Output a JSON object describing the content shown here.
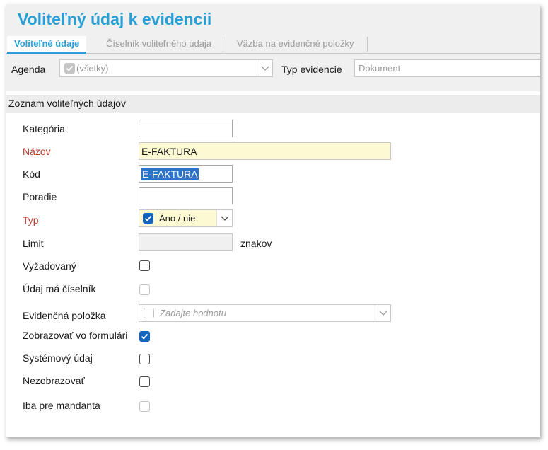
{
  "window": {
    "title": "Voliteľný údaj k evidencii"
  },
  "tabs": [
    {
      "label": "Voliteľné údaje",
      "active": true
    },
    {
      "label": "Číselník voliteľného údaja",
      "active": false
    },
    {
      "label": "Väzba na evidenčné položky",
      "active": false
    }
  ],
  "filter": {
    "agenda_label": "Agenda",
    "agenda_value": "(všetky)",
    "agenda_checked": true,
    "typ_label": "Typ evidencie",
    "typ_value": "Dokument"
  },
  "section": {
    "title": "Zoznam voliteľných údajov"
  },
  "form": {
    "kategoria": {
      "label": "Kategória",
      "value": ""
    },
    "nazov": {
      "label": "Názov",
      "value": "E-FAKTURA",
      "required": true
    },
    "kod": {
      "label": "Kód",
      "value": "E-FAKTURA",
      "selected": true
    },
    "poradie": {
      "label": "Poradie",
      "value": ""
    },
    "typ": {
      "label": "Typ",
      "value": "Áno / nie",
      "checked": true,
      "required": true
    },
    "limit": {
      "label": "Limit",
      "value": "",
      "unit": "znakov",
      "disabled": true
    },
    "vyzadovany": {
      "label": "Vyžadovaný",
      "checked": false
    },
    "udaj_ma_ciselnik": {
      "label": "Údaj má číselník",
      "checked": false,
      "disabled": true
    },
    "evidencna_polozka": {
      "label": "Evidenčná položka",
      "placeholder": "Zadajte hodnotu",
      "checked": false
    },
    "zobrazovat": {
      "label": "Zobrazovať vo formulári",
      "checked": true
    },
    "systemovy": {
      "label": "Systémový údaj",
      "checked": false
    },
    "nezobrazovat": {
      "label": "Nezobrazovať",
      "checked": false
    },
    "iba_pre_mandanta": {
      "label": "Iba pre mandanta",
      "checked": false,
      "disabled": true
    }
  },
  "colors": {
    "accent": "#2a9fd6",
    "required": "#c0392b",
    "check": "#1565c0",
    "highlight": "#fdf9d3"
  },
  "icons": [
    "check-icon",
    "chevron-down-icon"
  ]
}
